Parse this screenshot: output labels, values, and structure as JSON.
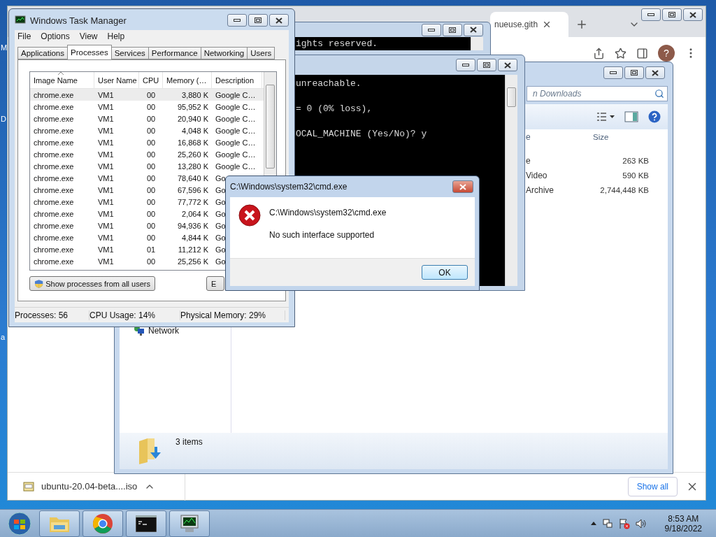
{
  "desktop": {
    "icon_labels": [
      "M",
      "D",
      "a"
    ]
  },
  "browser": {
    "tab": {
      "title": "nueuse.gith"
    },
    "avatar": "?",
    "download": {
      "file": "ubuntu-20.04-beta....iso",
      "show_all": "Show all"
    }
  },
  "explorer": {
    "search_placeholder": "n Downloads",
    "columns": [
      "e",
      "Size"
    ],
    "rows": [
      {
        "column_1": "e",
        "size": "263 KB"
      },
      {
        "column_1": "Video",
        "size": "590 KB"
      },
      {
        "column_1": "Archive",
        "size": "2,744,448 KB"
      }
    ],
    "nav_items": [
      "Network"
    ],
    "item_count": "3 items"
  },
  "cmd_back": {
    "lines": [
      "ights reserved."
    ]
  },
  "cmd_front": {
    "lines": [
      "unreachable.",
      "= 0 (0% loss),",
      "OCAL_MACHINE (Yes/No)? y"
    ]
  },
  "task_manager": {
    "title": "Windows Task Manager",
    "menu": [
      "File",
      "Options",
      "View",
      "Help"
    ],
    "tabs": [
      {
        "label": "Applications",
        "selected": false
      },
      {
        "label": "Processes",
        "selected": true
      },
      {
        "label": "Services",
        "selected": false
      },
      {
        "label": "Performance",
        "selected": false
      },
      {
        "label": "Networking",
        "selected": false
      },
      {
        "label": "Users",
        "selected": false
      }
    ],
    "columns": [
      "Image Name",
      "User Name",
      "CPU",
      "Memory (…",
      "Description"
    ],
    "rows": [
      {
        "image_name": "chrome.exe",
        "user_name": "VM1",
        "cpu": "00",
        "memory": "3,880 K",
        "description": "Google C…",
        "selected": true
      },
      {
        "image_name": "chrome.exe",
        "user_name": "VM1",
        "cpu": "00",
        "memory": "95,952 K",
        "description": "Google C…",
        "selected": false
      },
      {
        "image_name": "chrome.exe",
        "user_name": "VM1",
        "cpu": "00",
        "memory": "20,940 K",
        "description": "Google C…",
        "selected": false
      },
      {
        "image_name": "chrome.exe",
        "user_name": "VM1",
        "cpu": "00",
        "memory": "4,048 K",
        "description": "Google C…",
        "selected": false
      },
      {
        "image_name": "chrome.exe",
        "user_name": "VM1",
        "cpu": "00",
        "memory": "16,868 K",
        "description": "Google C…",
        "selected": false
      },
      {
        "image_name": "chrome.exe",
        "user_name": "VM1",
        "cpu": "00",
        "memory": "25,260 K",
        "description": "Google C…",
        "selected": false
      },
      {
        "image_name": "chrome.exe",
        "user_name": "VM1",
        "cpu": "00",
        "memory": "13,280 K",
        "description": "Google C…",
        "selected": false
      },
      {
        "image_name": "chrome.exe",
        "user_name": "VM1",
        "cpu": "00",
        "memory": "78,640 K",
        "description": "Go",
        "selected": false
      },
      {
        "image_name": "chrome.exe",
        "user_name": "VM1",
        "cpu": "00",
        "memory": "67,596 K",
        "description": "Go",
        "selected": false
      },
      {
        "image_name": "chrome.exe",
        "user_name": "VM1",
        "cpu": "00",
        "memory": "77,772 K",
        "description": "Go",
        "selected": false
      },
      {
        "image_name": "chrome.exe",
        "user_name": "VM1",
        "cpu": "00",
        "memory": "2,064 K",
        "description": "Go",
        "selected": false
      },
      {
        "image_name": "chrome.exe",
        "user_name": "VM1",
        "cpu": "00",
        "memory": "94,936 K",
        "description": "Go",
        "selected": false
      },
      {
        "image_name": "chrome.exe",
        "user_name": "VM1",
        "cpu": "00",
        "memory": "4,844 K",
        "description": "Go",
        "selected": false
      },
      {
        "image_name": "chrome.exe",
        "user_name": "VM1",
        "cpu": "01",
        "memory": "11,212 K",
        "description": "Go",
        "selected": false
      },
      {
        "image_name": "chrome.exe",
        "user_name": "VM1",
        "cpu": "00",
        "memory": "25,256 K",
        "description": "Go",
        "selected": false
      }
    ],
    "show_all_button": "Show processes from all users",
    "end_button": "E",
    "status": [
      "Processes: 56",
      "CPU Usage: 14%",
      "Physical Memory: 29%"
    ]
  },
  "dialog": {
    "title": "C:\\Windows\\system32\\cmd.exe",
    "heading": "C:\\Windows\\system32\\cmd.exe",
    "message": "No such interface supported",
    "button": "OK"
  },
  "taskbar": {
    "apps": [
      {
        "kind": "explorer"
      },
      {
        "kind": "chrome"
      },
      {
        "kind": "cmd"
      },
      {
        "kind": "taskmgr"
      }
    ],
    "time": "8:53 AM",
    "date": "9/18/2022"
  }
}
